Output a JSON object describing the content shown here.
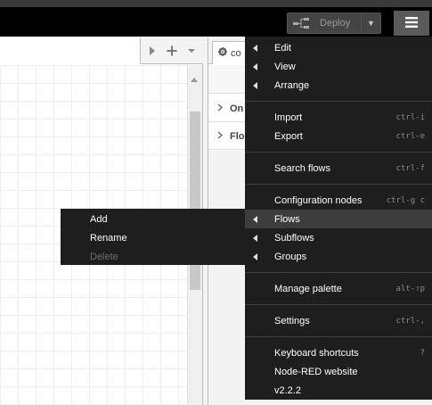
{
  "header": {
    "deploy_label": "Deploy",
    "icons": {
      "deploy": "deploy-icon",
      "caret": "chevron-down-icon",
      "menu": "hamburger-icon"
    }
  },
  "workspace": {
    "tools": {
      "scroll_right": "chevron-right-icon",
      "add_flow": "plus-icon",
      "flows_list": "chevron-down-icon"
    }
  },
  "sidebar": {
    "tab_label": "co",
    "tab_icon": "gear-icon",
    "sections": [
      {
        "label": "On"
      },
      {
        "label": "Flo"
      }
    ]
  },
  "main_menu": {
    "items": [
      {
        "label": "Edit",
        "submenu": true,
        "shortcut": ""
      },
      {
        "label": "View",
        "submenu": true,
        "shortcut": ""
      },
      {
        "label": "Arrange",
        "submenu": true,
        "shortcut": ""
      },
      {
        "label": "Import",
        "submenu": false,
        "shortcut": "ctrl-i"
      },
      {
        "label": "Export",
        "submenu": false,
        "shortcut": "ctrl-e"
      },
      {
        "label": "Search flows",
        "submenu": false,
        "shortcut": "ctrl-f"
      },
      {
        "label": "Configuration nodes",
        "submenu": false,
        "shortcut": "ctrl-g c"
      },
      {
        "label": "Flows",
        "submenu": true,
        "shortcut": "",
        "highlighted": true
      },
      {
        "label": "Subflows",
        "submenu": true,
        "shortcut": ""
      },
      {
        "label": "Groups",
        "submenu": true,
        "shortcut": ""
      },
      {
        "label": "Manage palette",
        "submenu": false,
        "shortcut": "alt-⇧p"
      },
      {
        "label": "Settings",
        "submenu": false,
        "shortcut": "ctrl-,"
      },
      {
        "label": "Keyboard shortcuts",
        "submenu": false,
        "shortcut": "?"
      },
      {
        "label": "Node-RED website",
        "submenu": false,
        "shortcut": ""
      },
      {
        "label": "v2.2.2",
        "submenu": false,
        "shortcut": ""
      }
    ]
  },
  "context_menu": {
    "items": [
      {
        "label": "Add",
        "disabled": false
      },
      {
        "label": "Rename",
        "disabled": false
      },
      {
        "label": "Delete",
        "disabled": true
      }
    ]
  },
  "colors": {
    "header_bg": "#000000",
    "menu_bg": "#1e1e1e",
    "menu_highlight": "#3d3d3d",
    "shortcut_text": "#8a8a8a",
    "disabled_text": "#6e6e6e"
  }
}
